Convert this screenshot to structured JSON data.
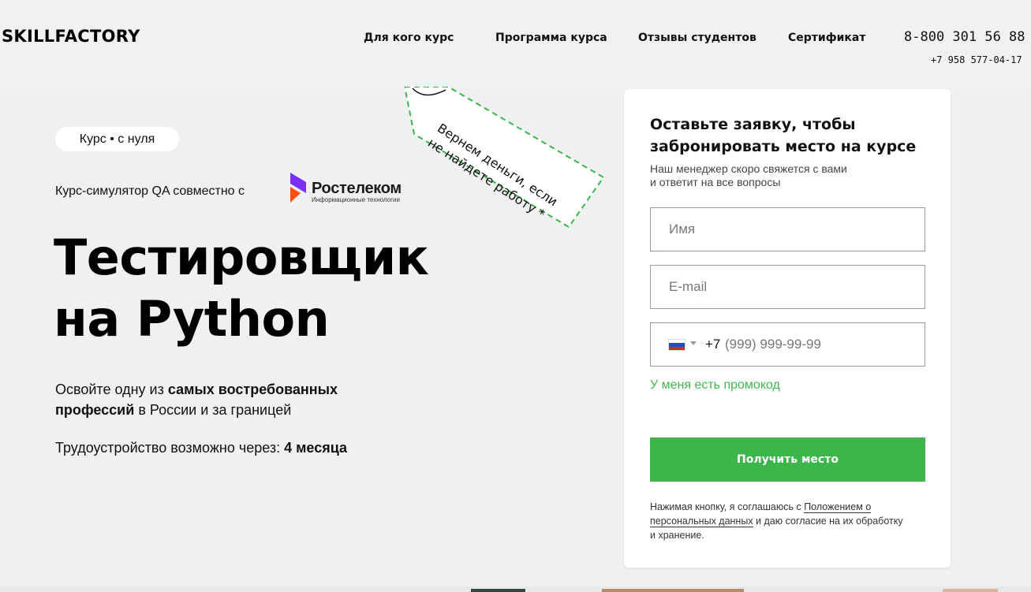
{
  "header": {
    "logo": "SKILLFACTORY",
    "nav": [
      {
        "label": "Для кого курс"
      },
      {
        "label": "Программа курса"
      },
      {
        "label": "Отзывы студентов"
      },
      {
        "label": "Сертификат"
      }
    ],
    "phone_main": "8-800 301 56 88",
    "phone_sub": "+7 958 577-04-17"
  },
  "hero": {
    "badge": "Курс • с нуля",
    "partner_prefix": "Курс-симулятор QA  совместно с",
    "partner_name": "Ростелеком",
    "partner_sub": "Информационные технологии",
    "title_line1": "Тестировщик",
    "title_line2": "на Python",
    "desc_part1": "Освойте одну из ",
    "desc_bold": "самых востребованных профессий",
    "desc_part2": " в России и за границей",
    "employ_prefix": "Трудоустройство возможно через: ",
    "employ_value": "4 месяца",
    "tag_line1": "Вернем деньги, если",
    "tag_line2": "не найдете работу  *"
  },
  "form": {
    "title": "Оставьте заявку, чтобы забронировать место на курсе",
    "subtitle_line1": "Наш менеджер скоро свяжется с вами",
    "subtitle_line2": "и ответит на все вопросы",
    "name_placeholder": "Имя",
    "email_placeholder": "E-mail",
    "dial_code": "+7",
    "phone_placeholder": "(999) 999-99-99",
    "promo_label": "У меня есть промокод",
    "submit_label": "Получить место",
    "consent_prefix": "Нажимая кнопку, я соглашаюсь с ",
    "consent_link": "Положением о персональных данных",
    "consent_suffix": " и даю согласие на их обработку и хранение."
  },
  "colors": {
    "accent_green": "#3cb54a",
    "promo_green": "#40b750",
    "rostelecom_purple": "#7b2ff7",
    "rostelecom_orange": "#ff4f12",
    "background": "#eef0f2"
  }
}
